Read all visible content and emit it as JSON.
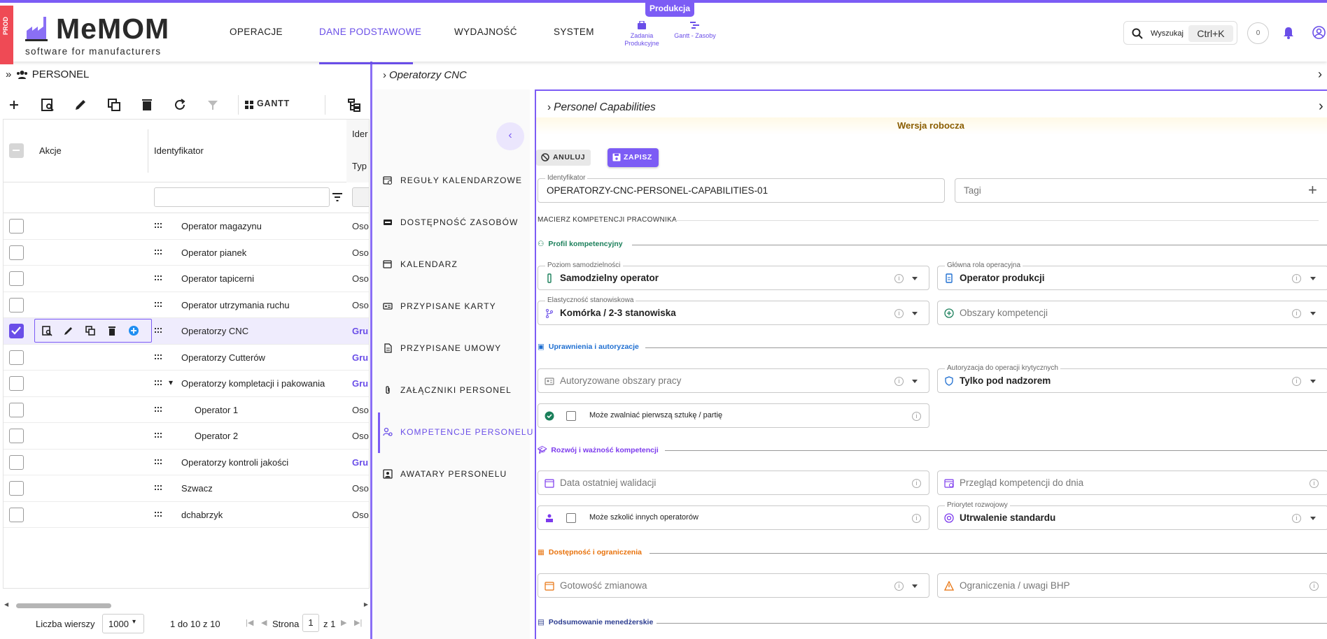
{
  "env_tag": "PROD",
  "brand": {
    "name": "MeMOM",
    "tagline": "software for manufacturers"
  },
  "nav": {
    "items": [
      "OPERACJE",
      "DANE PODSTAWOWE",
      "WYDAJNOŚĆ",
      "SYSTEM"
    ],
    "active_index": 1,
    "badge": "Produkcja",
    "quick": [
      {
        "label": "Zadania Produkcyjne",
        "icon": "task-icon"
      },
      {
        "label": "Gantt - Zasoby",
        "icon": "gantt-icon"
      }
    ],
    "search_label": "Wyszukaj",
    "search_shortcut": "Ctrl+K",
    "counter": "0"
  },
  "left_panel": {
    "title": "PERSONEL",
    "toolbar": {
      "gantt": "GANTT"
    },
    "columns": {
      "actions": "Akcje",
      "identifier": "Identyfikator",
      "ident_short": "Ider",
      "type_short": "Typ"
    },
    "rows": [
      {
        "id": "Operator magazynu",
        "type": "Oso",
        "group": false,
        "indent": 0,
        "selected": false
      },
      {
        "id": "Operator pianek",
        "type": "Oso",
        "group": false,
        "indent": 0,
        "selected": false
      },
      {
        "id": "Operator tapicerni",
        "type": "Oso",
        "group": false,
        "indent": 0,
        "selected": false
      },
      {
        "id": "Operator utrzymania ruchu",
        "type": "Oso",
        "group": false,
        "indent": 0,
        "selected": false
      },
      {
        "id": "Operatorzy CNC",
        "type": "Gru",
        "group": true,
        "indent": 0,
        "selected": true
      },
      {
        "id": "Operatorzy Cutterów",
        "type": "Gru",
        "group": true,
        "indent": 0,
        "selected": false
      },
      {
        "id": "Operatorzy kompletacji i pakowania",
        "type": "Gru",
        "group": true,
        "indent": 0,
        "selected": false,
        "expanded": true
      },
      {
        "id": "Operator 1",
        "type": "Oso",
        "group": false,
        "indent": 1,
        "selected": false
      },
      {
        "id": "Operator 2",
        "type": "Oso",
        "group": false,
        "indent": 1,
        "selected": false
      },
      {
        "id": "Operatorzy kontroli jakości",
        "type": "Gru",
        "group": true,
        "indent": 0,
        "selected": false
      },
      {
        "id": "Szwacz",
        "type": "Oso",
        "group": false,
        "indent": 0,
        "selected": false
      },
      {
        "id": "dchabrzyk",
        "type": "Oso",
        "group": false,
        "indent": 0,
        "selected": false
      }
    ],
    "pager": {
      "rows_label": "Liczba wierszy",
      "rows_value": "1000",
      "range": "1 do 10 z 10",
      "page_label": "Strona",
      "page_value": "1",
      "page_of": "z 1"
    }
  },
  "middle": {
    "title": "Operatorzy CNC",
    "side_nav": [
      {
        "label": "REGUŁY KALENDARZOWE",
        "icon": "calendar-rules-icon"
      },
      {
        "label": "DOSTĘPNOŚĆ ZASOBÓW",
        "icon": "availability-icon"
      },
      {
        "label": "KALENDARZ",
        "icon": "calendar-icon"
      },
      {
        "label": "PRZYPISANE KARTY",
        "icon": "card-icon"
      },
      {
        "label": "PRZYPISANE UMOWY",
        "icon": "contract-icon"
      },
      {
        "label": "ZAŁĄCZNIKI PERSONEL",
        "icon": "attachment-icon"
      },
      {
        "label": "KOMPETENCJE PERSONELU",
        "icon": "competence-icon"
      },
      {
        "label": "AWATARY PERSONELU",
        "icon": "avatar-icon"
      }
    ],
    "side_nav_active": 6
  },
  "form": {
    "title": "Personel Capabilities",
    "draft": "Wersja robocza",
    "cancel": "ANULUJ",
    "save": "ZAPISZ",
    "identifier_label": "Identyfikator",
    "identifier_value": "OPERATORZY-CNC-PERSONEL-CAPABILITIES-01",
    "tags_placeholder": "Tagi",
    "matrix_title": "MACIERZ KOMPETENCJI PRACOWNIKA",
    "sections": {
      "profile": "Profil kompetencyjny",
      "rights": "Uprawnienia i autoryzacje",
      "development": "Rozwój i ważność kompetencji",
      "availability": "Dostępność i ograniczenia",
      "summary": "Podsumowanie menedżerskie"
    },
    "section_colors": {
      "profile": "#1a7f5a",
      "rights": "#1f6fd1",
      "development": "#7c3aed",
      "availability": "#e8720c",
      "summary": "#2a3b8f"
    },
    "fields": {
      "autonomy": {
        "label": "Poziom samodzielności",
        "value": "Samodzielny operator"
      },
      "main_role": {
        "label": "Główna rola operacyjna",
        "value": "Operator produkcji"
      },
      "flexibility": {
        "label": "Elastyczność stanowiskowa",
        "value": "Komórka / 2-3 stanowiska"
      },
      "areas": {
        "placeholder": "Obszary kompetencji"
      },
      "authorized_areas": {
        "placeholder": "Autoryzowane obszary pracy"
      },
      "critical_ops": {
        "label": "Autoryzacja do operacji krytycznych",
        "value": "Tylko pod nadzorem"
      },
      "first_piece": {
        "text": "Może zwalniać pierwszą sztukę / partię"
      },
      "last_validation": {
        "placeholder": "Data ostatniej walidacji"
      },
      "review_date": {
        "placeholder": "Przegląd kompetencji do dnia"
      },
      "can_train": {
        "text": "Może szkolić innych operatorów"
      },
      "dev_priority": {
        "label": "Priorytet rozwojowy",
        "value": "Utrwalenie standardu"
      },
      "shift_ready": {
        "placeholder": "Gotowość zmianowa"
      },
      "restrictions": {
        "placeholder": "Ograniczenia / uwagi BHP"
      }
    }
  }
}
